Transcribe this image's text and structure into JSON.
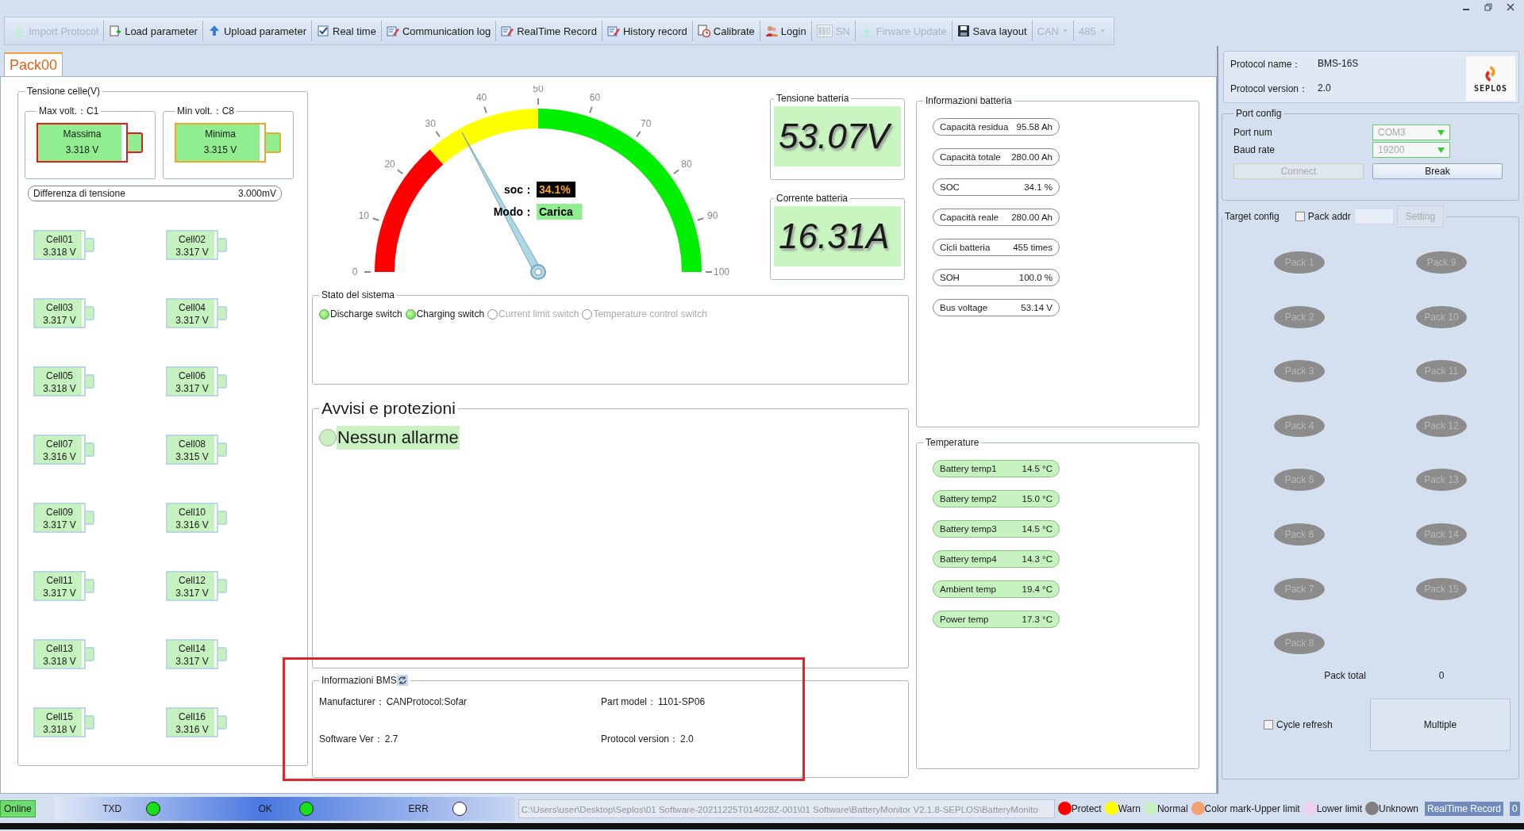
{
  "toolbar": [
    {
      "label": "Import Protocol",
      "kind": "import",
      "disabled": true
    },
    {
      "label": "Load parameter",
      "kind": "load",
      "disabled": false
    },
    {
      "label": "Upload parameter",
      "kind": "upload",
      "disabled": false
    },
    {
      "label": "Real time",
      "kind": "check",
      "disabled": false
    },
    {
      "label": "Communication log",
      "kind": "log",
      "disabled": false
    },
    {
      "label": "RealTime Record",
      "kind": "log",
      "disabled": false
    },
    {
      "label": "History record",
      "kind": "log",
      "disabled": false
    },
    {
      "label": "Calibrate",
      "kind": "calibrate",
      "disabled": false
    },
    {
      "label": "Login",
      "kind": "login",
      "disabled": false
    },
    {
      "label": "SN",
      "kind": "barcode",
      "disabled": true
    },
    {
      "label": "Firware Update",
      "kind": "import",
      "disabled": true
    },
    {
      "label": "Sava layout",
      "kind": "save",
      "disabled": false
    },
    {
      "label": "CAN",
      "kind": "dropdown",
      "disabled": true
    },
    {
      "label": "485",
      "kind": "dropdown",
      "disabled": true
    }
  ],
  "tabs": [
    {
      "label": "Pack00",
      "selected": true
    }
  ],
  "cell_voltages": {
    "title": "Tensione celle(V)",
    "max": {
      "title": "Max volt.：C1",
      "label": "Massima",
      "value": "3.318 V"
    },
    "min": {
      "title": "Min volt.：C8",
      "label": "Minima",
      "value": "3.315 V"
    },
    "difference": {
      "label": "Differenza di tensione",
      "value": "3.000mV"
    },
    "cells": [
      {
        "name": "Cell01",
        "voltage": "3.318 V"
      },
      {
        "name": "Cell02",
        "voltage": "3.317 V"
      },
      {
        "name": "Cell03",
        "voltage": "3.317 V"
      },
      {
        "name": "Cell04",
        "voltage": "3.317 V"
      },
      {
        "name": "Cell05",
        "voltage": "3.318 V"
      },
      {
        "name": "Cell06",
        "voltage": "3.317 V"
      },
      {
        "name": "Cell07",
        "voltage": "3.316 V"
      },
      {
        "name": "Cell08",
        "voltage": "3.315 V"
      },
      {
        "name": "Cell09",
        "voltage": "3.317 V"
      },
      {
        "name": "Cell10",
        "voltage": "3.316 V"
      },
      {
        "name": "Cell11",
        "voltage": "3.317 V"
      },
      {
        "name": "Cell12",
        "voltage": "3.317 V"
      },
      {
        "name": "Cell13",
        "voltage": "3.318 V"
      },
      {
        "name": "Cell14",
        "voltage": "3.317 V"
      },
      {
        "name": "Cell15",
        "voltage": "3.318 V"
      },
      {
        "name": "Cell16",
        "voltage": "3.316 V"
      }
    ]
  },
  "gauge": {
    "scale_labels": [
      "0",
      "10",
      "20",
      "30",
      "40",
      "50",
      "60",
      "70",
      "80",
      "90",
      "100"
    ],
    "level": 0.341,
    "soc_label": "soc：",
    "soc": "34.1%",
    "mode_label": "Modo：",
    "mode": "Carica"
  },
  "battery_voltage": {
    "title": "Tensione batteria",
    "value": "53.07V"
  },
  "battery_current": {
    "title": "Corrente batteria",
    "value": "16.31A"
  },
  "system_state": {
    "title": "Stato del sistema",
    "switches": [
      {
        "label": "Discharge switch",
        "on": true
      },
      {
        "label": "Charging switch",
        "on": true
      },
      {
        "label": "Current limit switch",
        "on": false
      },
      {
        "label": "Temperature control switch",
        "on": false
      }
    ]
  },
  "alarms": {
    "title": "Avvisi e protezioni",
    "items": [
      {
        "text": "Nessun allarme"
      }
    ]
  },
  "bms_info": {
    "title": "Informazioni BMS",
    "highlighted": true,
    "fields": [
      {
        "label": "Manufacturer：",
        "value": "CANProtocol:Sofar"
      },
      {
        "label": "Part model：",
        "value": "1101-SP06"
      },
      {
        "label": "Software Ver：",
        "value": "2.7"
      },
      {
        "label": "Protocol version：",
        "value": "2.0"
      }
    ]
  },
  "battery_info": {
    "title": "Informazioni batteria",
    "items": [
      {
        "label": "Capacità residua",
        "value": "95.58 Ah"
      },
      {
        "label": "Capacità totale",
        "value": "280.00 Ah"
      },
      {
        "label": "SOC",
        "value": "34.1 %"
      },
      {
        "label": "Capacità reale",
        "value": "280.00 Ah"
      },
      {
        "label": "Cicli batteria",
        "value": "455 times"
      },
      {
        "label": "SOH",
        "value": "100.0 %"
      },
      {
        "label": "Bus voltage",
        "value": "53.14 V"
      }
    ]
  },
  "temperature": {
    "title": "Temperature",
    "items": [
      {
        "label": "Battery temp1",
        "value": "14.5 °C"
      },
      {
        "label": "Battery temp2",
        "value": "15.0 °C"
      },
      {
        "label": "Battery temp3",
        "value": "14.5 °C"
      },
      {
        "label": "Battery temp4",
        "value": "14.3 °C"
      },
      {
        "label": "Ambient temp",
        "value": "19.4 °C"
      },
      {
        "label": "Power temp",
        "value": "17.3 °C"
      }
    ]
  },
  "protocol": {
    "name_label": "Protocol name：",
    "name": "BMS-16S",
    "version_label": "Protocol version：",
    "version": "2.0",
    "logo": "SEPLOS"
  },
  "port_config": {
    "title": "Port config",
    "fields": [
      {
        "label": "Port num",
        "value": "COM3",
        "disabled": true
      },
      {
        "label": "Baud rate",
        "value": "19200",
        "disabled": true
      }
    ],
    "buttons": [
      {
        "label": "Connect",
        "disabled": true
      },
      {
        "label": "Break",
        "disabled": false
      }
    ]
  },
  "target_config": {
    "title": "Target config",
    "pack_addr": {
      "label": "Pack addr",
      "checked": false
    },
    "setting": {
      "label": "Setting",
      "disabled": true
    },
    "packs": [
      {
        "label": "Pack 1",
        "disabled": true
      },
      {
        "label": "Pack 2",
        "disabled": true
      },
      {
        "label": "Pack 3",
        "disabled": true
      },
      {
        "label": "Pack 4",
        "disabled": true
      },
      {
        "label": "Pack 5",
        "disabled": true
      },
      {
        "label": "Pack 6",
        "disabled": true
      },
      {
        "label": "Pack 7",
        "disabled": true
      },
      {
        "label": "Pack 8",
        "disabled": true
      },
      {
        "label": "Pack 9",
        "disabled": true
      },
      {
        "label": "Pack 10",
        "disabled": true
      },
      {
        "label": "Pack 11",
        "disabled": true
      },
      {
        "label": "Pack 12",
        "disabled": true
      },
      {
        "label": "Pack 13",
        "disabled": true
      },
      {
        "label": "Pack 14",
        "disabled": true
      },
      {
        "label": "Pack 15",
        "disabled": true
      }
    ],
    "pack_total_label": "Pack total",
    "pack_total": "0",
    "cycle_refresh": {
      "label": "Cycle refresh",
      "checked": false
    },
    "multiple": {
      "label": "Multiple"
    }
  },
  "status_bar": {
    "connection": "Online",
    "indicators": [
      {
        "label": "TXD",
        "on": true
      },
      {
        "label": "OK",
        "on": true
      },
      {
        "label": "ERR",
        "on": false
      }
    ],
    "path": "C:\\Users\\user\\Desktop\\Seplos\\01 Software-20211225T014028Z-001\\01 Software\\BatteryMonitor V2.1.8-SEPLOS\\BatteryMonito",
    "legend": [
      {
        "label": "Protect",
        "color": "#ff0000"
      },
      {
        "label": "Warn",
        "color": "#ffff00"
      },
      {
        "label": "Normal",
        "color": "#c8f0c0"
      },
      {
        "label": "Color mark-Upper limit",
        "color": "#f4a070"
      },
      {
        "label": "Lower limit",
        "color": "#f0d0f0"
      },
      {
        "label": "Unknown",
        "color": "#808080"
      }
    ],
    "record_label": "RealTime Record",
    "record_count": "0"
  }
}
